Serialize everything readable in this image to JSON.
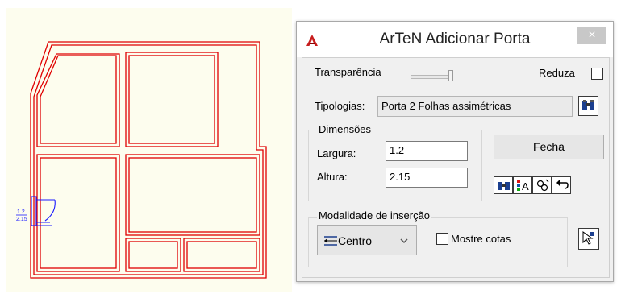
{
  "dialog": {
    "title": "ArTeN Adicionar Porta",
    "close_glyph": "×",
    "transparency_label": "Transparência",
    "transparency_level": 1.0,
    "reduce_label": "Reduza",
    "reduce_checked": false,
    "typology_label": "Tipologias:",
    "typology_value": "Porta 2 Folhas assimétricas",
    "dimensions_group": "Dimensões",
    "width_label": "Largura:",
    "width_value": "1.2",
    "height_label": "Altura:",
    "height_value": "2.15",
    "close_button": "Fecha",
    "insertion_group": "Modalidade de inserção",
    "insertion_mode": "Centro",
    "show_dims_label": "Mostre cotas",
    "show_dims_checked": false
  },
  "drawing": {
    "door_tag_top": "1.2",
    "door_tag_bottom": "2.15",
    "line_color": "#e00000"
  },
  "icons": {
    "app": "autocad-a-icon",
    "browse": "binoculars-icon",
    "find": "binoculars-icon",
    "properties": "color-swatch-icon",
    "pick": "pick-point-icon",
    "undo": "undo-icon",
    "insert": "insert-cursor-icon",
    "dropdown": "chevron-down-icon"
  }
}
